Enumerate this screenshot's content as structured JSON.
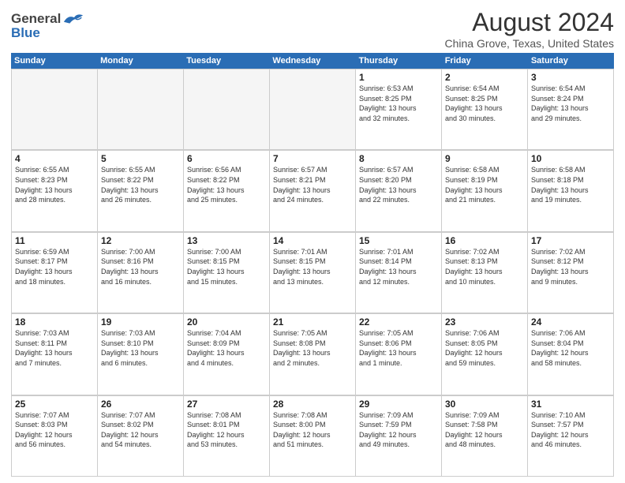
{
  "header": {
    "logo": {
      "general": "General",
      "blue": "Blue"
    },
    "title": "August 2024",
    "subtitle": "China Grove, Texas, United States"
  },
  "calendar": {
    "days": [
      "Sunday",
      "Monday",
      "Tuesday",
      "Wednesday",
      "Thursday",
      "Friday",
      "Saturday"
    ],
    "weeks": [
      [
        {
          "day": "",
          "empty": true
        },
        {
          "day": "",
          "empty": true
        },
        {
          "day": "",
          "empty": true
        },
        {
          "day": "",
          "empty": true
        },
        {
          "day": "1",
          "lines": [
            "Sunrise: 6:53 AM",
            "Sunset: 8:25 PM",
            "Daylight: 13 hours",
            "and 32 minutes."
          ]
        },
        {
          "day": "2",
          "lines": [
            "Sunrise: 6:54 AM",
            "Sunset: 8:25 PM",
            "Daylight: 13 hours",
            "and 30 minutes."
          ]
        },
        {
          "day": "3",
          "lines": [
            "Sunrise: 6:54 AM",
            "Sunset: 8:24 PM",
            "Daylight: 13 hours",
            "and 29 minutes."
          ]
        }
      ],
      [
        {
          "day": "4",
          "lines": [
            "Sunrise: 6:55 AM",
            "Sunset: 8:23 PM",
            "Daylight: 13 hours",
            "and 28 minutes."
          ]
        },
        {
          "day": "5",
          "lines": [
            "Sunrise: 6:55 AM",
            "Sunset: 8:22 PM",
            "Daylight: 13 hours",
            "and 26 minutes."
          ]
        },
        {
          "day": "6",
          "lines": [
            "Sunrise: 6:56 AM",
            "Sunset: 8:22 PM",
            "Daylight: 13 hours",
            "and 25 minutes."
          ]
        },
        {
          "day": "7",
          "lines": [
            "Sunrise: 6:57 AM",
            "Sunset: 8:21 PM",
            "Daylight: 13 hours",
            "and 24 minutes."
          ]
        },
        {
          "day": "8",
          "lines": [
            "Sunrise: 6:57 AM",
            "Sunset: 8:20 PM",
            "Daylight: 13 hours",
            "and 22 minutes."
          ]
        },
        {
          "day": "9",
          "lines": [
            "Sunrise: 6:58 AM",
            "Sunset: 8:19 PM",
            "Daylight: 13 hours",
            "and 21 minutes."
          ]
        },
        {
          "day": "10",
          "lines": [
            "Sunrise: 6:58 AM",
            "Sunset: 8:18 PM",
            "Daylight: 13 hours",
            "and 19 minutes."
          ]
        }
      ],
      [
        {
          "day": "11",
          "lines": [
            "Sunrise: 6:59 AM",
            "Sunset: 8:17 PM",
            "Daylight: 13 hours",
            "and 18 minutes."
          ]
        },
        {
          "day": "12",
          "lines": [
            "Sunrise: 7:00 AM",
            "Sunset: 8:16 PM",
            "Daylight: 13 hours",
            "and 16 minutes."
          ]
        },
        {
          "day": "13",
          "lines": [
            "Sunrise: 7:00 AM",
            "Sunset: 8:15 PM",
            "Daylight: 13 hours",
            "and 15 minutes."
          ]
        },
        {
          "day": "14",
          "lines": [
            "Sunrise: 7:01 AM",
            "Sunset: 8:15 PM",
            "Daylight: 13 hours",
            "and 13 minutes."
          ]
        },
        {
          "day": "15",
          "lines": [
            "Sunrise: 7:01 AM",
            "Sunset: 8:14 PM",
            "Daylight: 13 hours",
            "and 12 minutes."
          ]
        },
        {
          "day": "16",
          "lines": [
            "Sunrise: 7:02 AM",
            "Sunset: 8:13 PM",
            "Daylight: 13 hours",
            "and 10 minutes."
          ]
        },
        {
          "day": "17",
          "lines": [
            "Sunrise: 7:02 AM",
            "Sunset: 8:12 PM",
            "Daylight: 13 hours",
            "and 9 minutes."
          ]
        }
      ],
      [
        {
          "day": "18",
          "lines": [
            "Sunrise: 7:03 AM",
            "Sunset: 8:11 PM",
            "Daylight: 13 hours",
            "and 7 minutes."
          ]
        },
        {
          "day": "19",
          "lines": [
            "Sunrise: 7:03 AM",
            "Sunset: 8:10 PM",
            "Daylight: 13 hours",
            "and 6 minutes."
          ]
        },
        {
          "day": "20",
          "lines": [
            "Sunrise: 7:04 AM",
            "Sunset: 8:09 PM",
            "Daylight: 13 hours",
            "and 4 minutes."
          ]
        },
        {
          "day": "21",
          "lines": [
            "Sunrise: 7:05 AM",
            "Sunset: 8:08 PM",
            "Daylight: 13 hours",
            "and 2 minutes."
          ]
        },
        {
          "day": "22",
          "lines": [
            "Sunrise: 7:05 AM",
            "Sunset: 8:06 PM",
            "Daylight: 13 hours",
            "and 1 minute."
          ]
        },
        {
          "day": "23",
          "lines": [
            "Sunrise: 7:06 AM",
            "Sunset: 8:05 PM",
            "Daylight: 12 hours",
            "and 59 minutes."
          ]
        },
        {
          "day": "24",
          "lines": [
            "Sunrise: 7:06 AM",
            "Sunset: 8:04 PM",
            "Daylight: 12 hours",
            "and 58 minutes."
          ]
        }
      ],
      [
        {
          "day": "25",
          "lines": [
            "Sunrise: 7:07 AM",
            "Sunset: 8:03 PM",
            "Daylight: 12 hours",
            "and 56 minutes."
          ]
        },
        {
          "day": "26",
          "lines": [
            "Sunrise: 7:07 AM",
            "Sunset: 8:02 PM",
            "Daylight: 12 hours",
            "and 54 minutes."
          ]
        },
        {
          "day": "27",
          "lines": [
            "Sunrise: 7:08 AM",
            "Sunset: 8:01 PM",
            "Daylight: 12 hours",
            "and 53 minutes."
          ]
        },
        {
          "day": "28",
          "lines": [
            "Sunrise: 7:08 AM",
            "Sunset: 8:00 PM",
            "Daylight: 12 hours",
            "and 51 minutes."
          ]
        },
        {
          "day": "29",
          "lines": [
            "Sunrise: 7:09 AM",
            "Sunset: 7:59 PM",
            "Daylight: 12 hours",
            "and 49 minutes."
          ]
        },
        {
          "day": "30",
          "lines": [
            "Sunrise: 7:09 AM",
            "Sunset: 7:58 PM",
            "Daylight: 12 hours",
            "and 48 minutes."
          ]
        },
        {
          "day": "31",
          "lines": [
            "Sunrise: 7:10 AM",
            "Sunset: 7:57 PM",
            "Daylight: 12 hours",
            "and 46 minutes."
          ]
        }
      ]
    ]
  }
}
